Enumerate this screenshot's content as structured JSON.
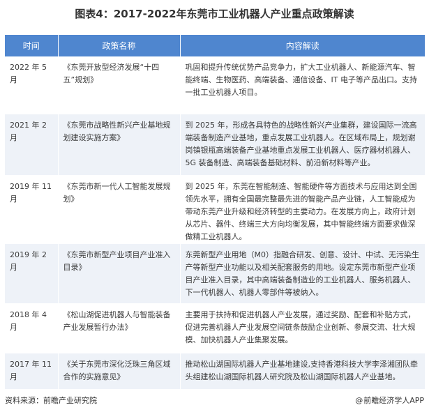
{
  "title": "图表4：2017-2022年东莞市工业机器人产业重点政策解读",
  "table": {
    "headers": [
      "时间",
      "政策名称",
      "内容解读"
    ],
    "rows": [
      {
        "time": "2022 年 5 月",
        "policy": "《东莞开放型经济发展“十四五”规划》",
        "content": "巩固和提升传统优势产品竞争力，扩大工业机器人、新能源汽车、智能终端、生物医药、高端装备、通信设备、IT 电子等产品出口。支持一批工业机器人项目。"
      },
      {
        "time": "2021 年 2 月",
        "policy": "《东莞市战略性新兴产业基地规划建设实施方案》",
        "content": "到 2025 年，形成各具特色的战略性新兴产业集群，建设国际一流高端装备制造产业基地，重点发展工业机器人。在区域布局上，规划谢岗镇银瓶高端装备产业基地重点发展工业机器人、医疗器材机器人、5G 装备制造、高端装备基础材料、前沿新材料等产业。"
      },
      {
        "time": "2019 年 11 月",
        "policy": "《东莞市新一代人工智能发展规划》",
        "content": "到 2025 年，东莞在智能制造、智能硬件等方面技术与应用达到全国领先水平，拥有全国最完整最先进的智能产品产业链，人工智能成为带动东莞产业升级和经济转型的主要动力。在发展方向上，政府计划从芯片、器件、终端三大方向均衡发展，其中智能终端方面要求做深做精工业机器人。"
      },
      {
        "time": "2019 年 2 月",
        "policy": "《东莞市新型产业项目产业准入目录》",
        "content": "东莞新型产业用地（M0）指融合研发、创意、设计、中试、无污染生产等新型产业功能以及相关配套服务的用地。设定东莞市新型产业项目产业准入目录，其中高端装备制造业的工业机器人、服务机器人、下一代机器人、机器人零部件等被纳入。"
      },
      {
        "time": "2018 年 4 月",
        "policy": "《松山湖促进机器人与智能装备产业发展暂行办法》",
        "content": "主要用于扶持和促进机器人产业发展，通过奖励、配套和补贴方式，促进完善机器人产业发展空间链条鼓励企业创新、参展交流、壮大规模、加快机器人产业集聚发展。"
      },
      {
        "time": "2017 年 11 月",
        "policy": "《关于东莞市深化泛珠三角区域合作的实施意见》",
        "content": "推动松山湖国际机器人产业基地建设,支持香港科技大学李泽湘团队牵头组建松山湖国际机器人研究院及松山湖国际机器人产业基地。"
      }
    ]
  },
  "footer": {
    "source": "资料来源：前瞻产业研究院",
    "credit_symbol": "@",
    "credit": "前瞻经济学人APP"
  }
}
